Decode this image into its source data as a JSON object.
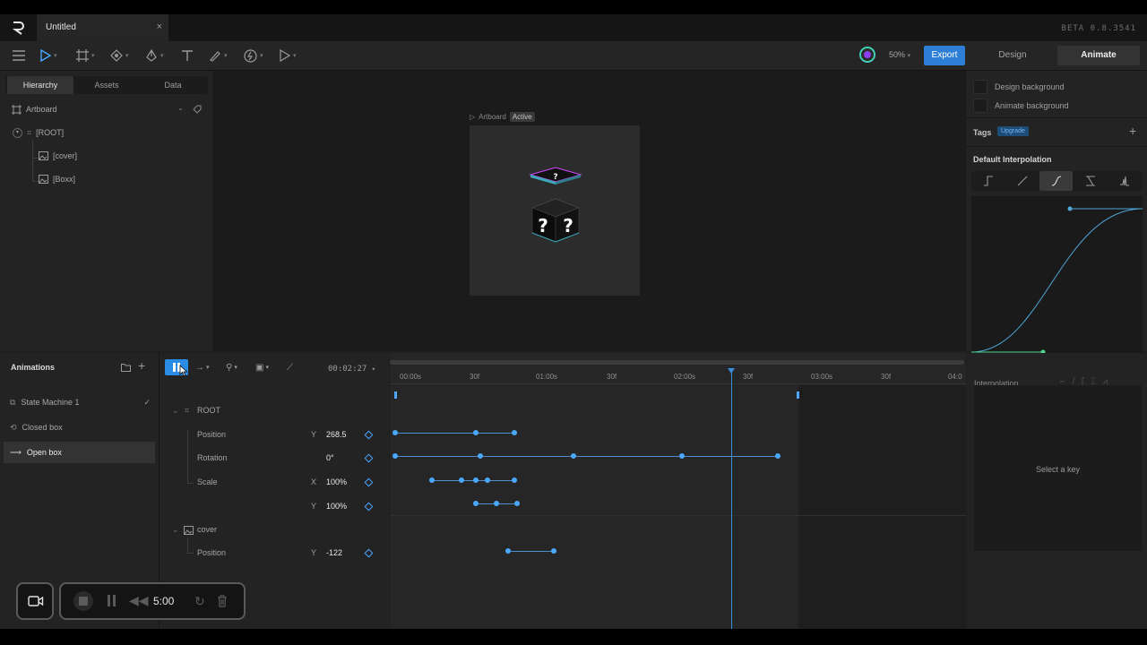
{
  "titlebar": {
    "doc_name": "Untitled",
    "close": "×",
    "version": "BETA 0.8.3541"
  },
  "toolbar": {
    "zoom": "50%",
    "export_label": "Export",
    "tabs": [
      "Design",
      "Animate"
    ],
    "active_tab": "Animate"
  },
  "left_panel": {
    "tabs": [
      "Hierarchy",
      "Assets",
      "Data"
    ],
    "active_tab": "Hierarchy",
    "artboard": "Artboard",
    "tree": [
      "[ROOT]",
      "[cover]",
      "[Boxx]"
    ]
  },
  "stage": {
    "artboard_label": "Artboard",
    "status": "Active"
  },
  "right_panel": {
    "design_background": "Design background",
    "animate_background": "Animate background",
    "tags_label": "Tags",
    "upgrade_label": "Upgrade",
    "default_interpolation": "Default Interpolation",
    "interpolation_label": "Interpolation",
    "select_key": "Select a key"
  },
  "animations": {
    "title": "Animations",
    "items": [
      {
        "label": "State Machine 1",
        "icon": "state-machine-icon"
      },
      {
        "label": "Closed box",
        "icon": "loop-icon"
      },
      {
        "label": "Open box",
        "icon": "arrow-right-icon"
      }
    ],
    "selected": "Open box"
  },
  "timeline": {
    "timecode": "00:02:27",
    "ruler": [
      "00:00s",
      "30f",
      "01:00s",
      "30f",
      "02:00s",
      "30f",
      "03:00s",
      "30f",
      "04:0"
    ],
    "root_label": "ROOT",
    "cover_label": "cover",
    "properties": [
      {
        "name": "Position",
        "axis": "Y",
        "value": "268.5"
      },
      {
        "name": "Rotation",
        "axis": "",
        "value": "0°"
      },
      {
        "name": "Scale",
        "axis": "X",
        "value": "100%"
      },
      {
        "name": "",
        "axis": "Y",
        "value": "100%"
      },
      {
        "name": "Position",
        "axis": "Y",
        "value": "-122"
      }
    ]
  },
  "recorder": {
    "time": "5:00"
  },
  "colors": {
    "accent": "#2c7fd4",
    "keyframe": "#4aa8ff",
    "curve": "#4fa8d8"
  }
}
